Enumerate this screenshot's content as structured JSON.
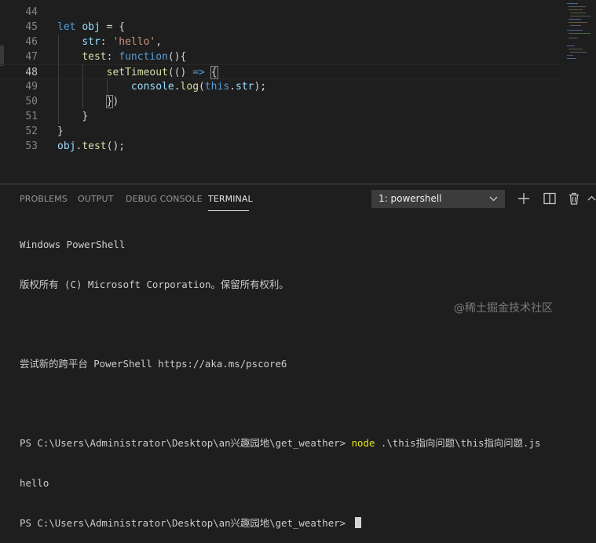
{
  "editor": {
    "lines": [
      {
        "num": "44"
      },
      {
        "num": "45"
      },
      {
        "num": "46"
      },
      {
        "num": "47"
      },
      {
        "num": "48"
      },
      {
        "num": "49"
      },
      {
        "num": "50"
      },
      {
        "num": "51"
      },
      {
        "num": "52"
      },
      {
        "num": "53"
      }
    ],
    "tokens": {
      "l45_let": "let",
      "l45_obj": "obj",
      "l45_rest": " = {",
      "l46_key": "str",
      "l46_colon": ": ",
      "l46_val": "'hello'",
      "l46_comma": ",",
      "l47_key": "test",
      "l47_colon": ": ",
      "l47_fn": "function",
      "l47_rest": "(){",
      "l48_call": "setTimeout",
      "l48_open": "(() ",
      "l48_arrow": "=>",
      "l48_brace": "{",
      "l49_console": "console",
      "l49_dot": ".",
      "l49_log": "log",
      "l49_open": "(",
      "l49_this": "this",
      "l49_dot2": ".",
      "l49_str": "str",
      "l49_close": ");",
      "l50_brace": "}",
      "l50_paren": ")",
      "l51_brace": "}",
      "l52_brace": "}",
      "l53_obj": "obj",
      "l53_dot": ".",
      "l53_test": "test",
      "l53_rest": "();"
    }
  },
  "panel": {
    "tabs": [
      "PROBLEMS",
      "OUTPUT",
      "DEBUG CONSOLE",
      "TERMINAL"
    ],
    "active_tab": "TERMINAL",
    "terminal_select": "1: powershell",
    "icons": [
      "add-icon",
      "split-icon",
      "trash-icon",
      "chevron-up-icon"
    ]
  },
  "terminal": {
    "line1": "Windows PowerShell",
    "line2": "版权所有 (C) Microsoft Corporation。保留所有权利。",
    "line3": "尝试新的跨平台 PowerShell https://aka.ms/pscore6",
    "prompt1": "PS C:\\Users\\Administrator\\Desktop\\an兴趣园地\\get_weather> ",
    "cmd": "node",
    "cmd_args": " .\\this指向问题\\this指向问题.js",
    "output": "hello",
    "prompt2": "PS C:\\Users\\Administrator\\Desktop\\an兴趣园地\\get_weather> "
  },
  "watermark": "@稀土掘金技术社区"
}
